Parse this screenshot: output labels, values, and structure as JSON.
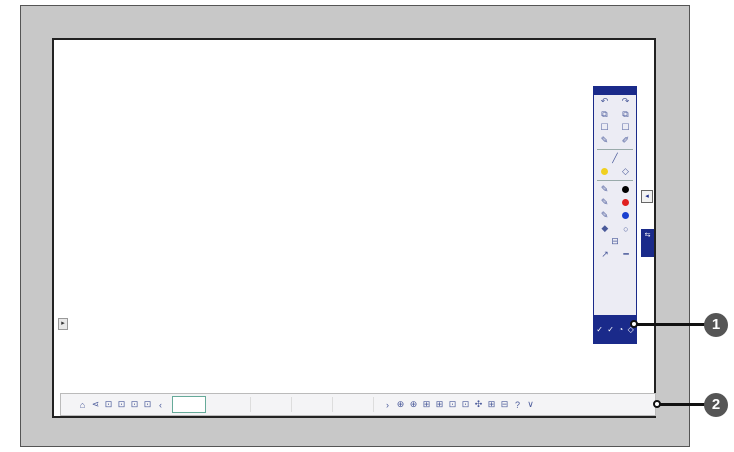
{
  "toolbar": {
    "rows": [
      [
        "↶",
        "↷"
      ],
      [
        "⧉",
        "⧉"
      ],
      [
        "☐",
        "☐"
      ],
      [
        "✎",
        "✐"
      ]
    ],
    "pen_colors": [
      "#000000",
      "#e02020",
      "#1a40d0"
    ],
    "bottom_glyphs": [
      "✓",
      "✓",
      "◔",
      "◇"
    ]
  },
  "side_buttons": {
    "collapse": "◂",
    "tab": "⇆"
  },
  "left_handle": "▸",
  "bottom_bar": {
    "left_icons": [
      "⌂",
      "⋖",
      "⊡",
      "⊡",
      "⊡",
      "⊡",
      "‹"
    ],
    "right_icons": [
      "›",
      "⊕",
      "⊕",
      "⊞",
      "⊞",
      "⊡",
      "⊡",
      "✣",
      "⊞",
      "⊟",
      "?",
      "∨"
    ]
  },
  "callouts": {
    "one": "1",
    "two": "2"
  }
}
